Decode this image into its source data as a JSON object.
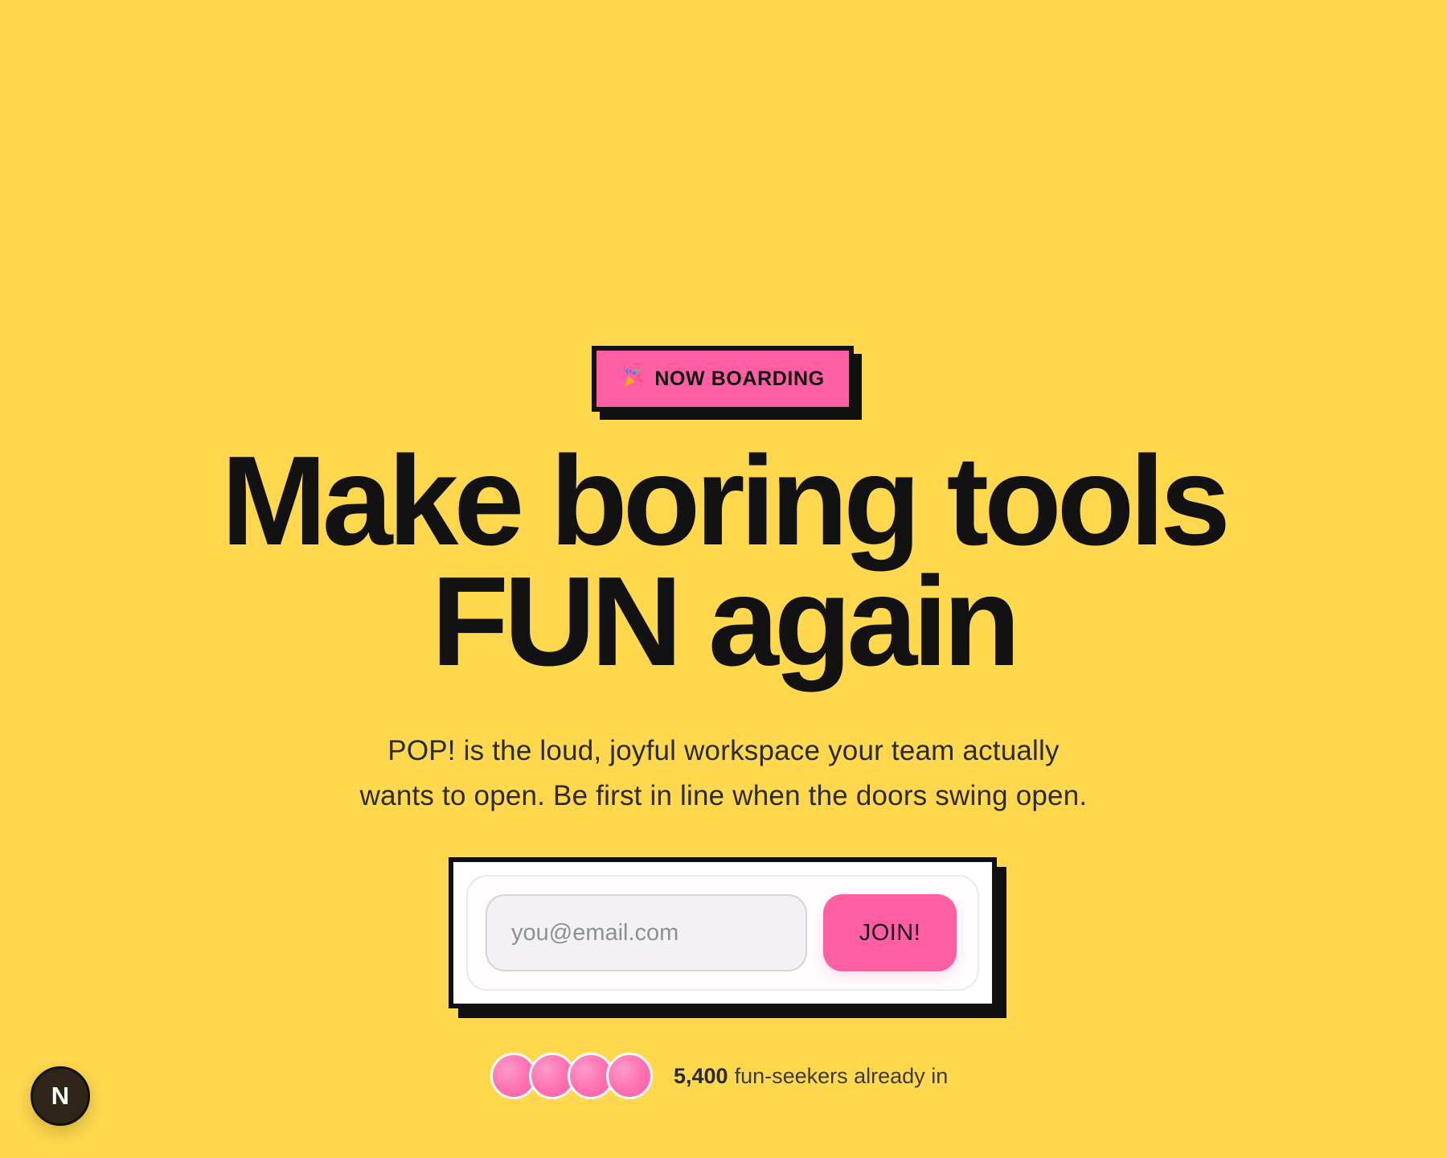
{
  "badge": {
    "label": "NOW BOARDING",
    "icon": "confetti-icon"
  },
  "hero": {
    "title_line_1": "Make boring tools",
    "title_line_2": "FUN again",
    "subtitle_line_1": "POP! is the loud, joyful workspace your team actually",
    "subtitle_line_2": "wants to open. Be first in line when the doors swing open."
  },
  "signup": {
    "email_placeholder": "you@email.com",
    "join_label": "JOIN!"
  },
  "social_proof": {
    "count": "5,400",
    "text": "fun-seekers already in",
    "avatars": [
      "avatar",
      "avatar",
      "avatar",
      "avatar"
    ]
  },
  "floating_button": {
    "label": "N"
  },
  "colors": {
    "background": "#FFD84D",
    "accent": "#FF5FA2",
    "ink": "#111111",
    "white": "#FFFFFF"
  }
}
